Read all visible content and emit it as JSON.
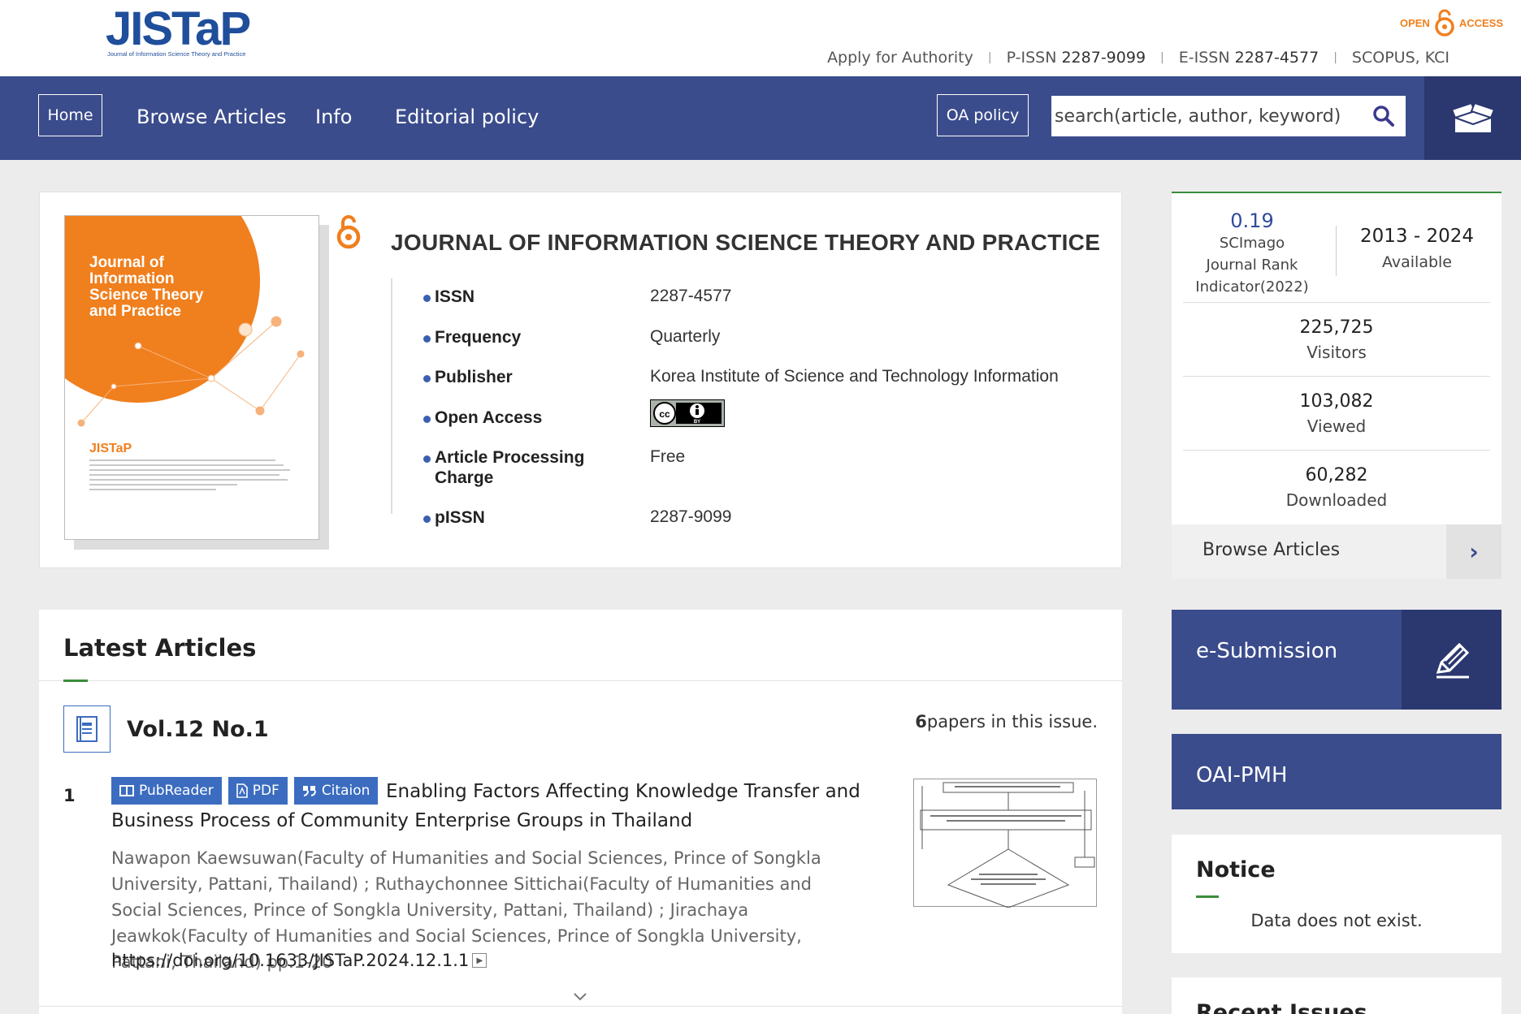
{
  "header": {
    "logo_text": "JISTaP",
    "logo_sub": "Journal of Information Science Theory and Practice",
    "oa_left": "OPEN",
    "oa_right": "ACCESS",
    "apply": "Apply for Authority",
    "pissn_label": "P-ISSN",
    "pissn": "2287-9099",
    "eissn_label": "E-ISSN",
    "eissn": "2287-4577",
    "indexing": "SCOPUS, KCI"
  },
  "nav": {
    "home": "Home",
    "browse": "Browse Articles",
    "info": "Info",
    "editorial": "Editorial policy",
    "oa_policy": "OA policy",
    "search_placeholder": "search(article, author, keyword)"
  },
  "journal": {
    "title": "JOURNAL OF INFORMATION SCIENCE THEORY AND PRACTICE",
    "cover_title": "Journal of Information Science Theory and Practice",
    "cover_brand": "JISTaP",
    "rows": [
      {
        "key": "ISSN",
        "value": "2287-4577"
      },
      {
        "key": "Frequency",
        "value": "Quarterly"
      },
      {
        "key": "Publisher",
        "value": "Korea Institute of Science and Technology Information"
      },
      {
        "key": "Open Access",
        "value": ""
      },
      {
        "key": "Article Processing Charge",
        "value": "Free"
      },
      {
        "key": "pISSN",
        "value": "2287-9099"
      }
    ]
  },
  "stats": {
    "sjr_value": "0.19",
    "sjr_label1": "SCImago",
    "sjr_label2": "Journal Rank",
    "sjr_label3": "Indicator(2022)",
    "years": "2013 - 2024",
    "years_label": "Available",
    "visitors": "225,725",
    "visitors_label": "Visitors",
    "viewed": "103,082",
    "viewed_label": "Viewed",
    "downloaded": "60,282",
    "downloaded_label": "Downloaded",
    "browse": "Browse Articles",
    "browse_arrow": "›"
  },
  "side": {
    "esubmission": "e-Submission",
    "oai": "OAI-PMH",
    "notice_title": "Notice",
    "notice_empty": "Data does not exist.",
    "recent_title": "Recent Issues"
  },
  "latest": {
    "title": "Latest Articles",
    "issue": "Vol.12 No.1",
    "count": "6",
    "count_suffix": "papers in this issue.",
    "article": {
      "num": "1",
      "btn_pubreader": "PubReader",
      "btn_pdf": "PDF",
      "btn_citation": "Citaion",
      "title": "Enabling Factors Affecting Knowledge Transfer and Business Process of Community Enterprise Groups in Thailand",
      "authors": "Nawapon Kaewsuwan(Faculty of Humanities and Social Sciences, Prince of Songkla University, Pattani, Thailand) ; Ruthaychonnee Sittichai(Faculty of Humanities and Social Sciences, Prince of Songkla University, Pattani, Thailand) ; Jirachaya Jeawkok(Faculty of Humanities and Social Sciences, Prince of Songkla University, Pattani, Thailand) pp.1-20",
      "doi": "https://doi.org/10.1633/JISTaP.2024.12.1.1"
    }
  },
  "colors": {
    "nav": "#3b4c8c",
    "nav_dark": "#2b3870",
    "accent_orange": "#f07f1e",
    "accent_green": "#3a8d3a",
    "logo_blue": "#1f4e9b"
  }
}
